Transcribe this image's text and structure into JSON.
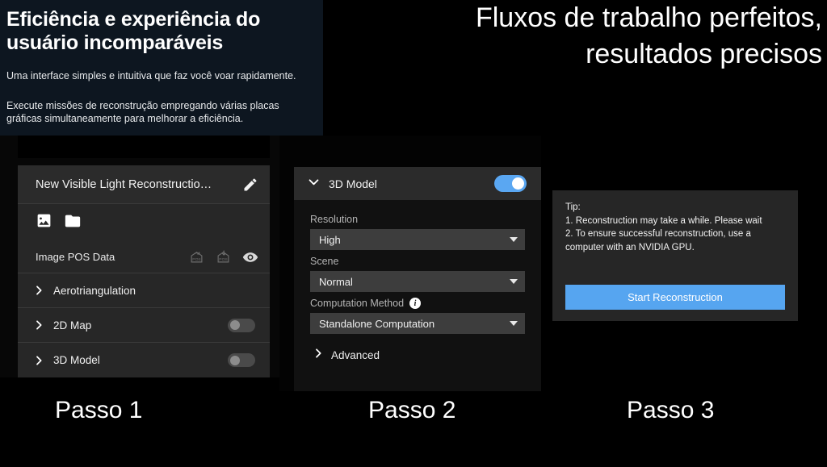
{
  "hero": {
    "title": "Eficiência e experiência do usuário incomparáveis",
    "paragraph1": "Uma interface simples e intuitiva que faz você voar rapidamente.",
    "paragraph2": "Execute missões de reconstrução empregando várias placas gráficas simultaneamente para melhorar a eficiência.",
    "background_color": "#0d1620"
  },
  "headline": "Fluxos de trabalho perfeitos, resultados precisos",
  "step1": {
    "project_title": "New Visible Light Reconstructio…",
    "edit_icon": "pencil-icon",
    "toolbar_icons": [
      "image-icon",
      "folder-icon"
    ],
    "pos_row": {
      "label": "Image POS Data",
      "icons": [
        "export-pos-icon",
        "import-pos-icon",
        "eye-icon"
      ]
    },
    "rows": [
      {
        "label": "Aerotriangulation",
        "has_toggle": false,
        "toggle_on": false
      },
      {
        "label": "2D Map",
        "has_toggle": true,
        "toggle_on": false
      },
      {
        "label": "3D Model",
        "has_toggle": true,
        "toggle_on": false
      }
    ]
  },
  "step2": {
    "header_label": "3D Model",
    "header_toggle_on": true,
    "fields": [
      {
        "label": "Resolution",
        "value": "High",
        "info": false
      },
      {
        "label": "Scene",
        "value": "Normal",
        "info": false
      },
      {
        "label": "Computation Method",
        "value": "Standalone Computation",
        "info": true
      }
    ],
    "advanced_label": "Advanced",
    "toggle_accent": "#5aa7f2"
  },
  "step3": {
    "tip_lines": [
      "Tip:",
      "1. Reconstruction may take a while. Please wait",
      "2. To ensure successful reconstruction, use a",
      "computer with an NVIDIA GPU."
    ],
    "button_label": "Start Reconstruction",
    "button_color": "#56a5f0"
  },
  "captions": {
    "step1": "Passo 1",
    "step2": "Passo 2",
    "step3": "Passo 3"
  }
}
